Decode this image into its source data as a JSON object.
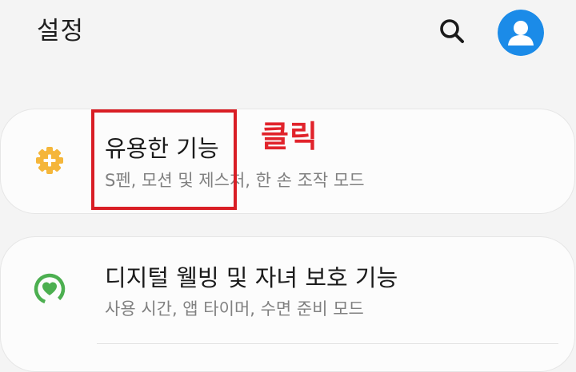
{
  "header": {
    "title": "설정",
    "search_icon": "search-icon",
    "avatar_icon": "account-avatar-icon",
    "avatar_color": "#1b8be8"
  },
  "cards": [
    {
      "icon": "gear-plus-icon",
      "icon_color": "#f5b63a",
      "title": "유용한 기능",
      "subtitle": "S펜, 모션 및 제스처, 한 손 조작 모드"
    },
    {
      "icon": "digital-wellbeing-icon",
      "icon_color": "#4caf50",
      "title": "디지털 웰빙 및 자녀 보호 기능",
      "subtitle": "사용 시간, 앱 타이머, 수면 준비 모드"
    }
  ],
  "annotation": {
    "label": "클릭",
    "color": "#e1232b"
  }
}
